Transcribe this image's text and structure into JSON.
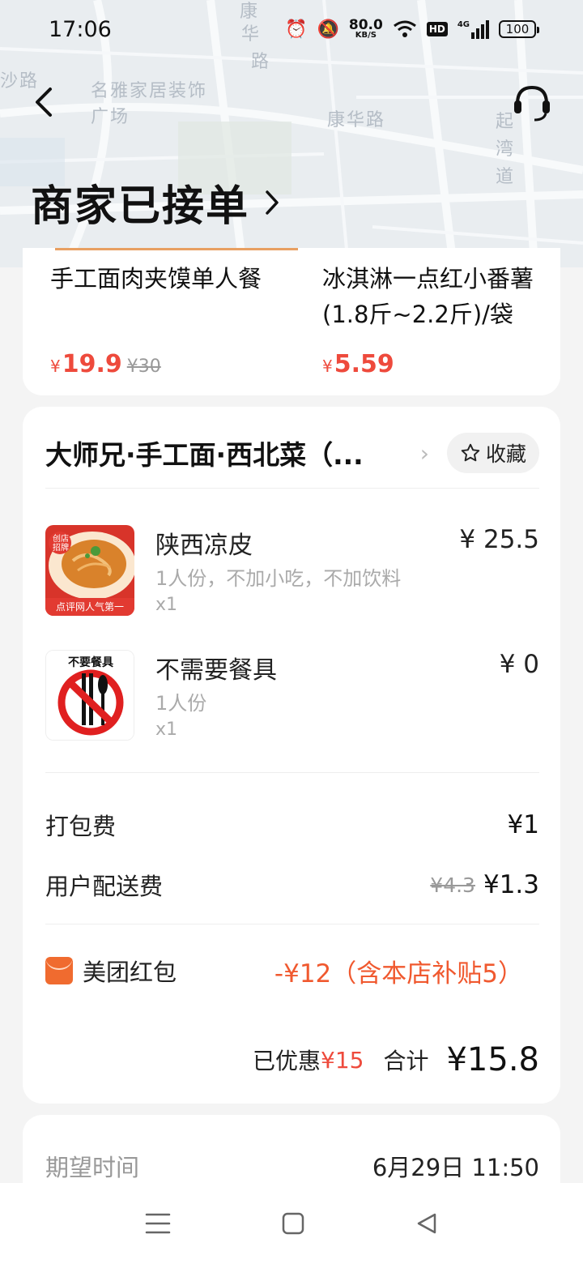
{
  "status_bar": {
    "time": "17:06",
    "net_speed": "80.0",
    "net_unit": "KB/S",
    "hd": "HD",
    "signal": "4G",
    "battery": "100"
  },
  "map": {
    "labels": [
      "康",
      "华",
      "路",
      "沙路",
      "名雅家居装饰",
      "广场",
      "康华路",
      "起",
      "湾",
      "道"
    ]
  },
  "header": {
    "title": "商家已接单",
    "title_arrow": "›"
  },
  "recommend": {
    "items": [
      {
        "name_line1": "手工面肉夹馍单人餐",
        "name_line2": "",
        "currency": "¥",
        "price": "19.9",
        "old_price": "¥30"
      },
      {
        "name_line1": "冰淇淋一点红小番薯",
        "name_line2": "(1.8斤~2.2斤)/袋",
        "currency": "¥",
        "price": "5.59",
        "old_price": ""
      }
    ]
  },
  "order": {
    "shop_name": "大师兄·手工面·西北菜（...",
    "shop_arrow": "›",
    "favorite_label": "收藏",
    "items": [
      {
        "name": "陕西凉皮",
        "desc": "1人份，不加小吃，不加饮料",
        "qty": "x1",
        "price": "¥ 25.5",
        "thumb_badge": "创店招牌",
        "thumb_caption": "点评网人气第一"
      },
      {
        "name": "不需要餐具",
        "desc": "1人份",
        "qty": "x1",
        "price": "¥ 0",
        "thumb_caption": "不要餐具"
      }
    ],
    "packing_fee_label": "打包费",
    "packing_fee": "¥1",
    "delivery_fee_label": "用户配送费",
    "delivery_fee_old": "¥4.3",
    "delivery_fee": "¥1.3",
    "coupon_label": "美团红包",
    "coupon_value": "-¥12（含本店补贴5）",
    "saved_label": "已优惠",
    "saved_value": "¥15",
    "total_label": "合计",
    "total_value": "¥15.8"
  },
  "expected": {
    "label": "期望时间",
    "value": "6月29日 11:50"
  },
  "colors": {
    "price_red": "#ee4a3c",
    "coupon_orange": "#f06b2f",
    "background": "#f4f4f4"
  }
}
